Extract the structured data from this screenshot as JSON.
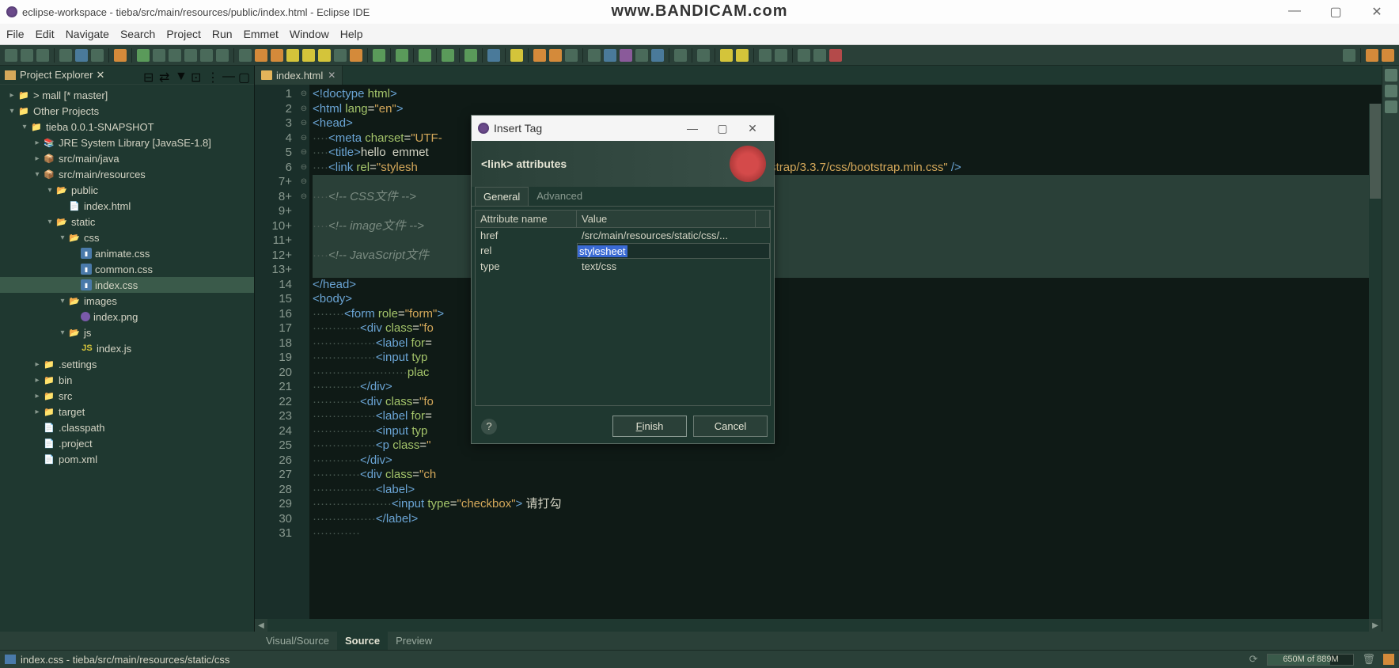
{
  "title_bar": {
    "text": "eclipse-workspace - tieba/src/main/resources/public/index.html - Eclipse IDE"
  },
  "watermark": "www.BANDICAM.com",
  "menu": [
    "File",
    "Edit",
    "Navigate",
    "Search",
    "Project",
    "Run",
    "Emmet",
    "Window",
    "Help"
  ],
  "project_explorer": {
    "title": "Project Explorer",
    "tree": {
      "mall": "> mall [* master]",
      "other": "Other Projects",
      "tieba": "tieba  0.0.1-SNAPSHOT",
      "jre": "JRE System Library [JavaSE-1.8]",
      "src_java": "src/main/java",
      "src_res": "src/main/resources",
      "public": "public",
      "index_html": "index.html",
      "static": "static",
      "css": "css",
      "animate": "animate.css",
      "common": "common.css",
      "index_css": "index.css",
      "images": "images",
      "index_png": "index.png",
      "js": "js",
      "index_js": "index.js",
      "settings": ".settings",
      "bin": "bin",
      "src": "src",
      "target": "target",
      "classpath": ".classpath",
      "project": ".project",
      "pom": "pom.xml"
    }
  },
  "editor": {
    "tab": {
      "label": "index.html"
    },
    "lines": {
      "l1": [
        "<!",
        "doctype",
        " html",
        ">"
      ],
      "l2": [
        "<",
        "html",
        " lang",
        "=",
        "\"en\"",
        ">"
      ],
      "l3": [
        "<",
        "head",
        ">"
      ],
      "l4_indent": "····",
      "l4": [
        "<",
        "meta",
        " charset",
        "=",
        "\"UTF-"
      ],
      "l5_indent": "····",
      "l5": [
        "<",
        "title",
        ">",
        "hello  emmet"
      ],
      "l6_indent": "····",
      "l6": [
        "<",
        "link",
        " rel",
        "=",
        "\"stylesh"
      ],
      "l6_tail": [
        "itter-bootstrap/3.3.7/css/bootstrap.min.css\"",
        " ",
        "/>"
      ],
      "l7": "7+",
      "l8_indent": "····",
      "l8": "<!-- CSS文件 -->",
      "l9": "9+",
      "l10_indent": "····",
      "l10": "<!-- image文件 -->",
      "l11": "11+",
      "l12_indent": "····",
      "l12": "<!-- JavaScript文件",
      "l13": "13+",
      "l14": [
        "</",
        "head",
        ">"
      ],
      "l15": [
        "<",
        "body",
        ">"
      ],
      "l16_indent": "········",
      "l16": [
        "<",
        "form",
        " role",
        "=",
        "\"form\"",
        ">"
      ],
      "l17_indent": "············",
      "l17": [
        "<",
        "div",
        " class",
        "=",
        "\"fo"
      ],
      "l18_indent": "················",
      "l18": [
        "<",
        "label",
        " for",
        "="
      ],
      "l19_indent": "················",
      "l19": [
        "<",
        "input",
        " typ"
      ],
      "l20_indent": "························",
      "l20": [
        "plac"
      ],
      "l21_indent": "············",
      "l21": [
        "</",
        "div",
        ">"
      ],
      "l22_indent": "············",
      "l22": [
        "<",
        "div",
        " class",
        "=",
        "\"fo"
      ],
      "l23_indent": "················",
      "l23": [
        "<",
        "label",
        " for",
        "="
      ],
      "l24_indent": "················",
      "l24": [
        "<",
        "input",
        " typ"
      ],
      "l25_indent": "················",
      "l25": [
        "<",
        "p",
        " class",
        "=",
        "\""
      ],
      "l26_indent": "············",
      "l26": [
        "</",
        "div",
        ">"
      ],
      "l27_indent": "············",
      "l27": [
        "<",
        "div",
        " class",
        "=",
        "\"ch"
      ],
      "l28_indent": "················",
      "l28": [
        "<",
        "label",
        ">"
      ],
      "l29_indent": "····················",
      "l29": [
        "<",
        "input",
        " type",
        "=",
        "\"checkbox\"",
        ">",
        " 请打勾"
      ],
      "l30_indent": "················",
      "l30": [
        "</",
        "label",
        ">"
      ],
      "l31_indent": "············",
      "l31": ""
    },
    "bottom_tabs": [
      "Visual/Source",
      "Source",
      "Preview"
    ]
  },
  "dialog": {
    "title": "Insert Tag",
    "header": "<link> attributes",
    "tabs": [
      "General",
      "Advanced"
    ],
    "columns": [
      "Attribute name",
      "Value"
    ],
    "rows": [
      {
        "name": "href",
        "value": "/src/main/resources/static/css/..."
      },
      {
        "name": "rel",
        "value": "stylesheet",
        "editing": true
      },
      {
        "name": "type",
        "value": "text/css"
      }
    ],
    "buttons": {
      "finish": "Finish",
      "cancel": "Cancel"
    }
  },
  "status_bar": {
    "path": "index.css - tieba/src/main/resources/static/css",
    "memory": "650M of 889M"
  }
}
